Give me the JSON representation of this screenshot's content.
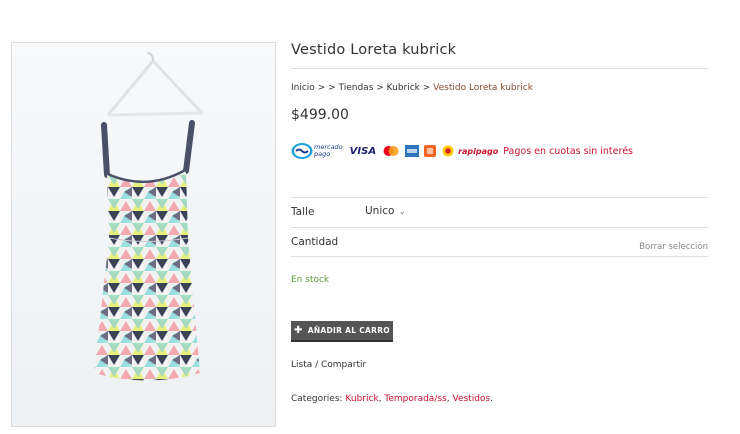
{
  "product": {
    "title": "Vestido Loreta kubrick",
    "price": "$499.00",
    "image_alt": "Vestido estampado triangulos en perchero"
  },
  "breadcrumb": {
    "inicio": "Inicio",
    "sep1": " > > ",
    "tiendas": "Tiendas",
    "sep2": " > ",
    "kubrick": "Kubrick",
    "sep3": " > ",
    "current": "Vestido Loreta kubrick"
  },
  "payments": {
    "mp_top": "mercado",
    "mp_bottom": "pago",
    "visa": "VISA",
    "rapipago": "rapipago",
    "installments_text": "Pagos en cuotas sin interés"
  },
  "variations": {
    "talle_label": "Talle",
    "talle_value": "Unico",
    "cantidad_label": "Cantidad",
    "reset_label": "Borrar selección"
  },
  "stock": {
    "status": "En stock"
  },
  "cart": {
    "button_label": "AÑADIR AL CARRO"
  },
  "share": {
    "label": "Lista / Compartir"
  },
  "categories": {
    "label": "Categories:",
    "items": [
      "Kubrick",
      "Temporada/ss",
      "Vestidos"
    ]
  },
  "colors": {
    "accent_red": "#c8102e",
    "stock_green": "#5a9a3a",
    "button_bg": "#555555",
    "breadcrumb_current": "#8b4a2f"
  }
}
